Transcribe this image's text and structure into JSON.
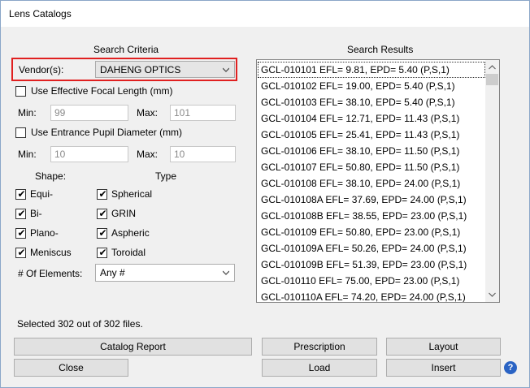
{
  "window": {
    "title": "Lens Catalogs"
  },
  "search_criteria": {
    "heading": "Search Criteria",
    "vendor_label": "Vendor(s):",
    "vendor_value": "DAHENG OPTICS",
    "efl": {
      "label": "Use Effective Focal Length (mm)",
      "min_label": "Min:",
      "min_value": "99",
      "max_label": "Max:",
      "max_value": "101",
      "checked": false
    },
    "epd": {
      "label": "Use Entrance Pupil Diameter (mm)",
      "min_label": "Min:",
      "min_value": "10",
      "max_label": "Max:",
      "max_value": "10",
      "checked": false
    },
    "shape_heading": "Shape:",
    "type_heading": "Type",
    "shapes": [
      "Equi-",
      "Bi-",
      "Plano-",
      "Meniscus"
    ],
    "types": [
      "Spherical",
      "GRIN",
      "Aspheric",
      "Toroidal"
    ],
    "elements_label": "# Of Elements:",
    "elements_value": "Any #",
    "checkmark": "✔"
  },
  "search_results": {
    "heading": "Search Results",
    "items": [
      "GCL-010101 EFL= 9.81, EPD= 5.40 (P,S,1)",
      "GCL-010102 EFL= 19.00, EPD= 5.40 (P,S,1)",
      "GCL-010103 EFL= 38.10, EPD= 5.40 (P,S,1)",
      "GCL-010104 EFL= 12.71, EPD= 11.43 (P,S,1)",
      "GCL-010105 EFL= 25.41, EPD= 11.43 (P,S,1)",
      "GCL-010106 EFL= 38.10, EPD= 11.50 (P,S,1)",
      "GCL-010107 EFL= 50.80, EPD= 11.50 (P,S,1)",
      "GCL-010108 EFL= 38.10, EPD= 24.00 (P,S,1)",
      "GCL-010108A EFL= 37.69, EPD= 24.00 (P,S,1)",
      "GCL-010108B EFL= 38.55, EPD= 23.00 (P,S,1)",
      "GCL-010109 EFL= 50.80, EPD= 23.00 (P,S,1)",
      "GCL-010109A EFL= 50.26, EPD= 24.00 (P,S,1)",
      "GCL-010109B EFL= 51.39, EPD= 23.00 (P,S,1)",
      "GCL-010110 EFL= 75.00, EPD= 23.00 (P,S,1)",
      "GCL-010110A EFL= 74.20, EPD= 24.00 (P,S,1)"
    ]
  },
  "status": "Selected 302 out of 302 files.",
  "buttons": {
    "catalog_report": "Catalog Report",
    "prescription": "Prescription",
    "layout": "Layout",
    "close": "Close",
    "load": "Load",
    "insert": "Insert",
    "help": "?"
  },
  "colors": {
    "highlight_box": "#e02020",
    "help_icon": "#2a63c4"
  }
}
